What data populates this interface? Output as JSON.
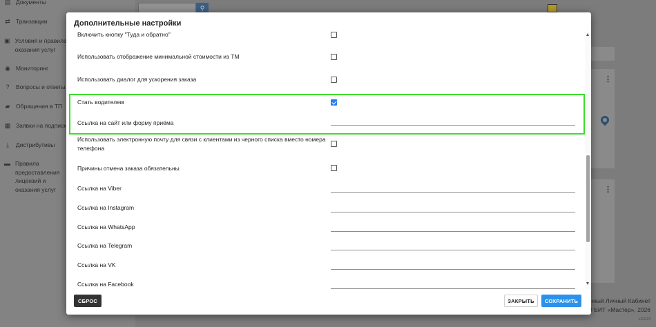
{
  "app": {
    "sidebar": {
      "items": [
        {
          "icon": "documents-icon",
          "label": "Документы"
        },
        {
          "icon": "transactions-icon",
          "label": "Транзакции"
        },
        {
          "icon": "terms-icon",
          "label": "Условия и правила оказания услуг"
        },
        {
          "icon": "eye-icon",
          "label": "Мониторинг"
        },
        {
          "icon": "help-icon",
          "label": "Вопросы и ответы"
        },
        {
          "icon": "chat-icon",
          "label": "Обращения в ТП"
        },
        {
          "icon": "list-icon",
          "label": "Заявки на подписк"
        },
        {
          "icon": "download-icon",
          "label": "Дистрибутивы"
        },
        {
          "icon": "folder-icon",
          "label": "Правила предоставления лицензий и оказания услуг"
        }
      ]
    },
    "footer": {
      "line1": "инный Личный Кабинет",
      "line2": "ОО БИТ «Мастер», 2026",
      "version": "v.3.6.24"
    }
  },
  "modal": {
    "title": "Дополнительные настройки",
    "rows": [
      {
        "label": "Включить кнопку \"Туда и обратно\"",
        "control": "checkbox",
        "checked": false
      },
      {
        "label": "Использовать отображение минимальной стоимости из ТМ",
        "control": "checkbox",
        "checked": false
      },
      {
        "label": "Использовать диалог для ускорения заказа",
        "control": "checkbox",
        "checked": false
      },
      {
        "label": "Стать водителем",
        "control": "checkbox",
        "checked": true
      },
      {
        "label": "Ссылка на сайт или форму приёма",
        "control": "input",
        "value": ""
      },
      {
        "label": "Использовать электронную почту для связи с клиентами из черного списка вместо номера телефона",
        "control": "checkbox",
        "checked": false
      },
      {
        "label": "Причины отмена заказа обязательны",
        "control": "checkbox",
        "checked": false
      },
      {
        "label": "Ссылка на Viber",
        "control": "input",
        "value": ""
      },
      {
        "label": "Ссылка на Instagram",
        "control": "input",
        "value": ""
      },
      {
        "label": "Ссылка на WhatsApp",
        "control": "input",
        "value": ""
      },
      {
        "label": "Ссылка на Telegram",
        "control": "input",
        "value": ""
      },
      {
        "label": "Ссылка на VK",
        "control": "input",
        "value": ""
      },
      {
        "label": "Ссылка на Facebook",
        "control": "input",
        "value": ""
      }
    ],
    "buttons": {
      "reset": "СБРОС",
      "close": "ЗАКРЫТЬ",
      "save": "СОХРАНИТЬ"
    }
  },
  "colors": {
    "highlight": "#3ddc2a",
    "accent": "#2b92ec",
    "checkbox_checked": "#2b7ce8",
    "reset_button": "#333333"
  }
}
